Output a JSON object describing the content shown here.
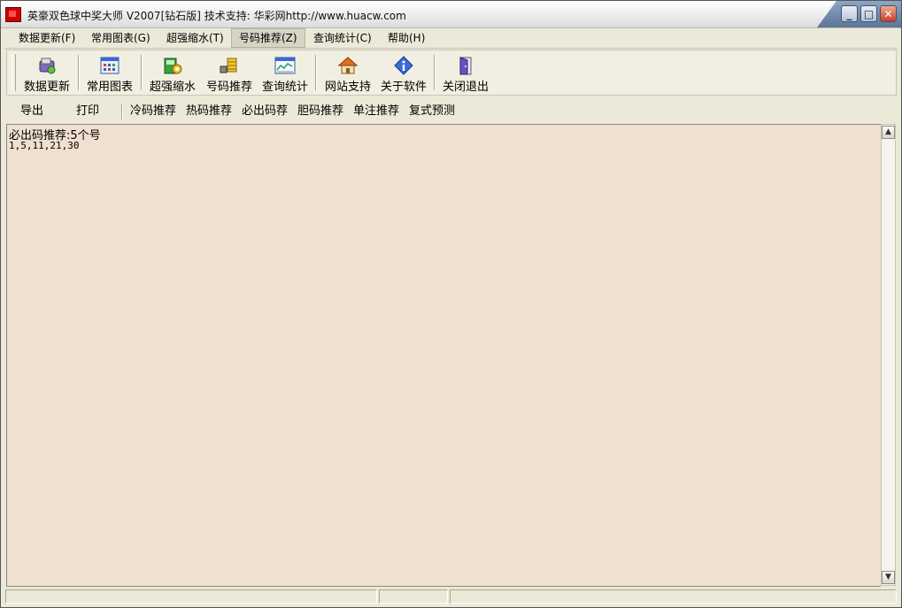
{
  "window": {
    "title": "英豪双色球中奖大师   V2007[钻石版]  技术支持: 华彩网http://www.huacw.com",
    "minimize": "_",
    "maximize": "□",
    "close": "✕"
  },
  "menu": [
    {
      "label": "数据更新(F)"
    },
    {
      "label": "常用图表(G)"
    },
    {
      "label": "超强缩水(T)"
    },
    {
      "label": "号码推荐(Z)"
    },
    {
      "label": "查询统计(C)"
    },
    {
      "label": "帮助(H)"
    }
  ],
  "toolbar": [
    {
      "label": "数据更新",
      "icon": "database-update-icon"
    },
    {
      "label": "常用图表",
      "icon": "chart-grid-icon"
    },
    {
      "label": "超强缩水",
      "icon": "filter-book-icon"
    },
    {
      "label": "号码推荐",
      "icon": "coin-stack-icon"
    },
    {
      "label": "查询统计",
      "icon": "statistics-window-icon"
    },
    {
      "label": "网站支持",
      "icon": "home-icon"
    },
    {
      "label": "关于软件",
      "icon": "info-icon"
    },
    {
      "label": "关闭退出",
      "icon": "exit-door-icon"
    }
  ],
  "subbar": {
    "export": "导出",
    "print": "打印",
    "items": [
      "冷码推荐",
      "热码推荐",
      "必出码荐",
      "胆码推荐",
      "单注推荐",
      "复式预测"
    ]
  },
  "content": {
    "line1": "必出码推荐:5个号",
    "line2": "1,5,11,21,30"
  },
  "scroll": {
    "up": "▲",
    "down": "▼"
  },
  "colors": {
    "content_bg": "#f0e0d0",
    "chrome_bg": "#ece9d8"
  }
}
